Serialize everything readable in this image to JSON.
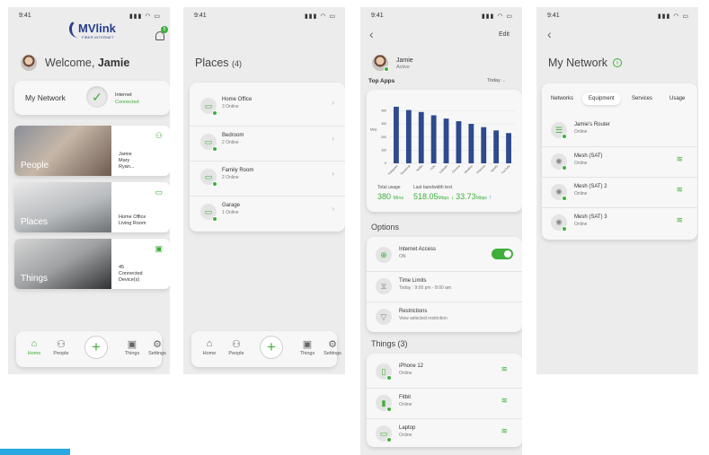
{
  "status_time": "9:41",
  "screen1": {
    "logo_main": "MVlink",
    "logo_sub": "FIBER INTERNET",
    "notif_badge": "5",
    "welcome_prefix": "Welcome, ",
    "user_name": "Jamie",
    "network_label": "My Network",
    "internet_label": "Internet",
    "internet_status": "Connected",
    "tiles": [
      {
        "label": "People",
        "info": [
          "Jamie",
          "Mary",
          "Ryan..."
        ],
        "icon": "people-icon"
      },
      {
        "label": "Places",
        "info": [
          "Home Office",
          "Living Room"
        ],
        "icon": "place-icon"
      },
      {
        "label": "Things",
        "info": [
          "45",
          "Connected",
          "Device(s)"
        ],
        "icon": "device-icon"
      }
    ]
  },
  "nav": [
    "Home",
    "People",
    "Things",
    "Settings"
  ],
  "screen2": {
    "title": "Places",
    "count": "(4)",
    "places": [
      {
        "name": "Home Office",
        "status": "3 Online"
      },
      {
        "name": "Bedroom",
        "status": "2 Online"
      },
      {
        "name": "Family Room",
        "status": "2 Online"
      },
      {
        "name": "Garage",
        "status": "1 Online"
      }
    ]
  },
  "screen3": {
    "edit": "Edit",
    "user_name": "Jamie",
    "user_status": "Active",
    "top_apps": "Top Apps",
    "period": "Today",
    "total_usage_label": "Total usage",
    "total_usage_value": "380",
    "total_usage_unit": "Mins",
    "bandwidth_label": "Last bandwidth test",
    "download_value": "518.05",
    "download_unit": "Mbps",
    "upload_value": "33.73",
    "upload_unit": "Mbps",
    "options_title": "Options",
    "options": [
      {
        "name": "Internet Access",
        "detail": "ON"
      },
      {
        "name": "Time Limits",
        "detail": "Today : 9:00 pm - 8:00 am"
      },
      {
        "name": "Restrictions",
        "detail": "View selected restriction"
      }
    ],
    "things_title": "Things (3)",
    "things": [
      {
        "name": "iPhone 12",
        "status": "Online"
      },
      {
        "name": "Fitbit",
        "status": "Online"
      },
      {
        "name": "Laptop",
        "status": "Online"
      }
    ]
  },
  "screen4": {
    "title": "My Network",
    "tabs": [
      "Networks",
      "Equipment",
      "Services",
      "Usage"
    ],
    "active_tab": "Equipment",
    "equipment": [
      {
        "name": "Jamie's Router",
        "status": "Online"
      },
      {
        "name": "Mesh (SAT)",
        "status": "Online"
      },
      {
        "name": "Mesh (SAT) 2",
        "status": "Online"
      },
      {
        "name": "Mesh (SAT) 3",
        "status": "Online"
      }
    ]
  },
  "chart_data": {
    "type": "bar",
    "categories": [
      "Instagram",
      "Facebook",
      "Netflix",
      "Hulu",
      "LinkedIn",
      "Chrome",
      "Weather",
      "Pinterest",
      "Spotify",
      "YouTube"
    ],
    "values": [
      430,
      405,
      390,
      365,
      340,
      320,
      300,
      275,
      250,
      230
    ],
    "yticks": [
      "0",
      "100",
      "200",
      "300",
      "400"
    ],
    "ylabel": "Mins",
    "ylim": [
      0,
      450
    ],
    "color": "#2e4a8f"
  },
  "colors": {
    "accent": "#3fae3a",
    "brand_blue": "#2a3f8f"
  }
}
